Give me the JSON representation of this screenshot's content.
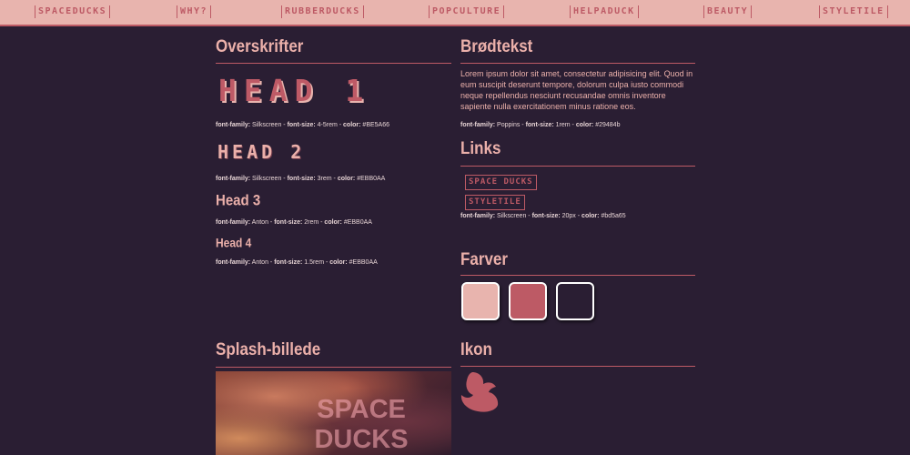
{
  "nav": [
    {
      "label": "SPACEDUCKS"
    },
    {
      "label": "WHY?"
    },
    {
      "label": "RUBBERDUCKS"
    },
    {
      "label": "POPCULTURE"
    },
    {
      "label": "HELPADUCK"
    },
    {
      "label": "BEAUTY"
    },
    {
      "label": "STYLETILE"
    }
  ],
  "headings": {
    "title": "Overskrifter",
    "h1": "HEAD 1",
    "h1_spec": [
      "font-family:",
      " Silkscreen - ",
      "font-size:",
      " 4-5rem - ",
      "color:",
      " #BE5A66"
    ],
    "h2": "HEAD 2",
    "h2_spec": [
      "font-family:",
      " Silkscreen - ",
      "font-size:",
      " 3rem - ",
      "color:",
      " #EBB0AA"
    ],
    "h3": "Head 3",
    "h3_spec": [
      "font-family:",
      " Anton - ",
      "font-size:",
      " 2rem - ",
      "color:",
      " #EBB0AA"
    ],
    "h4": "Head 4",
    "h4_spec": [
      "font-family:",
      " Anton - ",
      "font-size:",
      " 1.5rem - ",
      "color:",
      " #EBB0AA"
    ]
  },
  "bodytext": {
    "title": "Brødtekst",
    "text": "Lorem ipsum dolor sit amet, consectetur adipisicing elit. Quod in eum suscipit deserunt tempore, dolorum culpa iusto commodi neque repellendus nesciunt recusandae omnis inventore sapiente nulla exercitationem minus ratione eos.",
    "spec": [
      "font-family:",
      " Poppins - ",
      "font-size:",
      " 1rem - ",
      "color:",
      " #29484b"
    ]
  },
  "links": {
    "title": "Links",
    "items": [
      {
        "label": "SPACE DUCKS"
      },
      {
        "label": "STYLETILE"
      }
    ],
    "spec": [
      "font-family:",
      " Silkscreen - ",
      "font-size:",
      " 20px - ",
      "color:",
      " #bd5a65"
    ]
  },
  "colors": {
    "title": "Farver",
    "swatches": [
      "#e8b4ae",
      "#bd5a65",
      "#2a1e33"
    ]
  },
  "splash": {
    "title": "Splash-billede",
    "text_line1": "SPACE",
    "text_line2": "DUCKS"
  },
  "icon": {
    "title": "Ikon",
    "name": "duck-head-icon"
  }
}
